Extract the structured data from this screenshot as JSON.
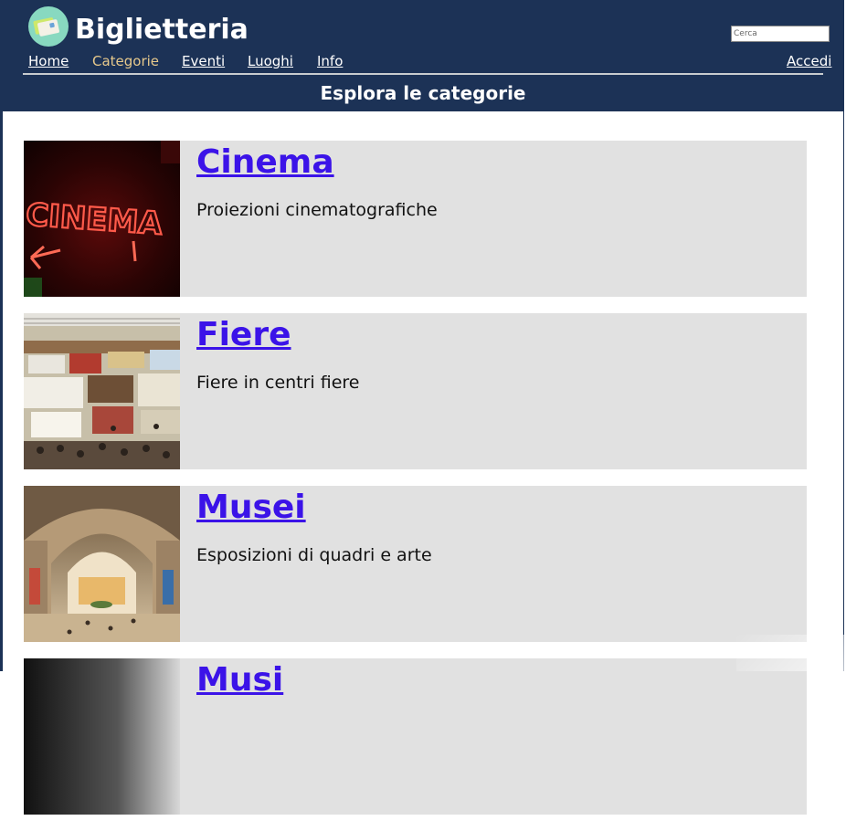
{
  "header": {
    "site_title": "Biglietteria",
    "search_placeholder": "Cerca",
    "nav": {
      "home": "Home",
      "categorie": "Categorie",
      "eventi": "Eventi",
      "luoghi": "Luoghi",
      "info": "Info",
      "accedi": "Accedi"
    },
    "active_nav": "Categorie",
    "page_subtitle": "Esplora le categorie"
  },
  "categories": [
    {
      "title": "Cinema",
      "description": "Proiezioni cinematografiche",
      "image_sign_text": "CINEMA"
    },
    {
      "title": "Fiere",
      "description": "Fiere in centri fiere"
    },
    {
      "title": "Musei",
      "description": "Esposizioni di quadri e arte"
    },
    {
      "title": "Musi"
    }
  ],
  "colors": {
    "header_bg": "#1c3256",
    "card_bg": "#e1e1e1",
    "link": "#3b13e8",
    "nav_active": "#e7c98c"
  }
}
